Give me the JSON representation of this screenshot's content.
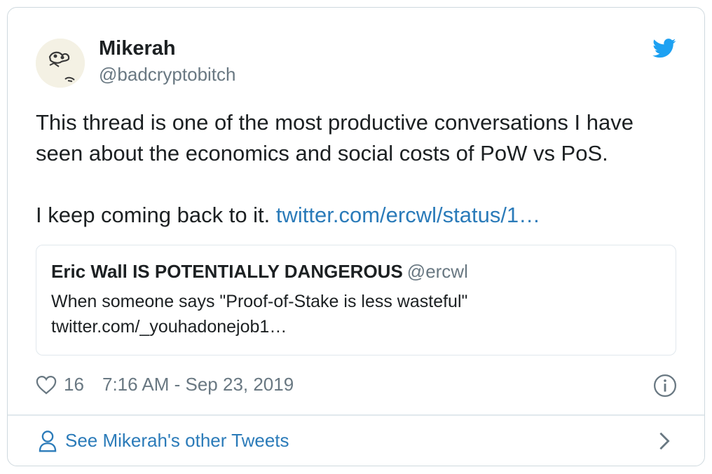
{
  "author": {
    "display_name": "Mikerah",
    "handle": "@badcryptobitch"
  },
  "tweet": {
    "paragraph1": "This thread is one of the most productive conversations I have seen about the economics and social costs of PoW vs PoS.",
    "paragraph2_text": "I keep coming back to it. ",
    "paragraph2_link": "twitter.com/ercwl/status/1…"
  },
  "quoted_tweet": {
    "author_name": "Eric Wall IS POTENTIALLY DANGEROUS",
    "author_handle": "@ercwl",
    "text_line1": "When someone says \"Proof-of-Stake is less wasteful\"",
    "text_line2": "twitter.com/_youhadonejob1…"
  },
  "meta": {
    "like_count": "16",
    "timestamp": "7:16 AM - Sep 23, 2019"
  },
  "footer": {
    "label": "See Mikerah's other Tweets"
  },
  "icons": [
    "twitter-bird-icon",
    "heart-icon",
    "info-icon",
    "person-icon",
    "chevron-right-icon"
  ],
  "colors": {
    "link": "#2b7bb9",
    "twitter_blue": "#1da1f2",
    "text": "#1c2022",
    "secondary_text": "#697882",
    "border": "#cfd9de"
  }
}
